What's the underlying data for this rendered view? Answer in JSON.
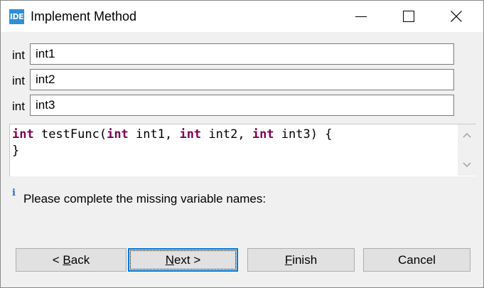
{
  "window": {
    "title": "Implement Method",
    "app_icon_text": "IDE"
  },
  "params": [
    {
      "type": "int",
      "name": "int1"
    },
    {
      "type": "int",
      "name": "int2"
    },
    {
      "type": "int",
      "name": "int3"
    }
  ],
  "code": {
    "line1": {
      "ret": "int",
      "fname": " testFunc(",
      "t1": "int",
      "n1": " int1, ",
      "t2": "int",
      "n2": " int2, ",
      "t3": "int",
      "n3": " int3) {"
    },
    "line2": "}"
  },
  "info": {
    "icon": "i",
    "message": "Please complete the missing variable names:"
  },
  "buttons": {
    "back_prefix": "< ",
    "back_mnemonic": "B",
    "back_rest": "ack",
    "next_mnemonic": "N",
    "next_rest": "ext >",
    "finish_mnemonic": "F",
    "finish_rest": "inish",
    "cancel": "Cancel"
  },
  "colors": {
    "keyword": "#7f0055",
    "accent": "#0078d7",
    "app_icon": "#2e8fd6",
    "info_icon": "#2d6bc4"
  }
}
